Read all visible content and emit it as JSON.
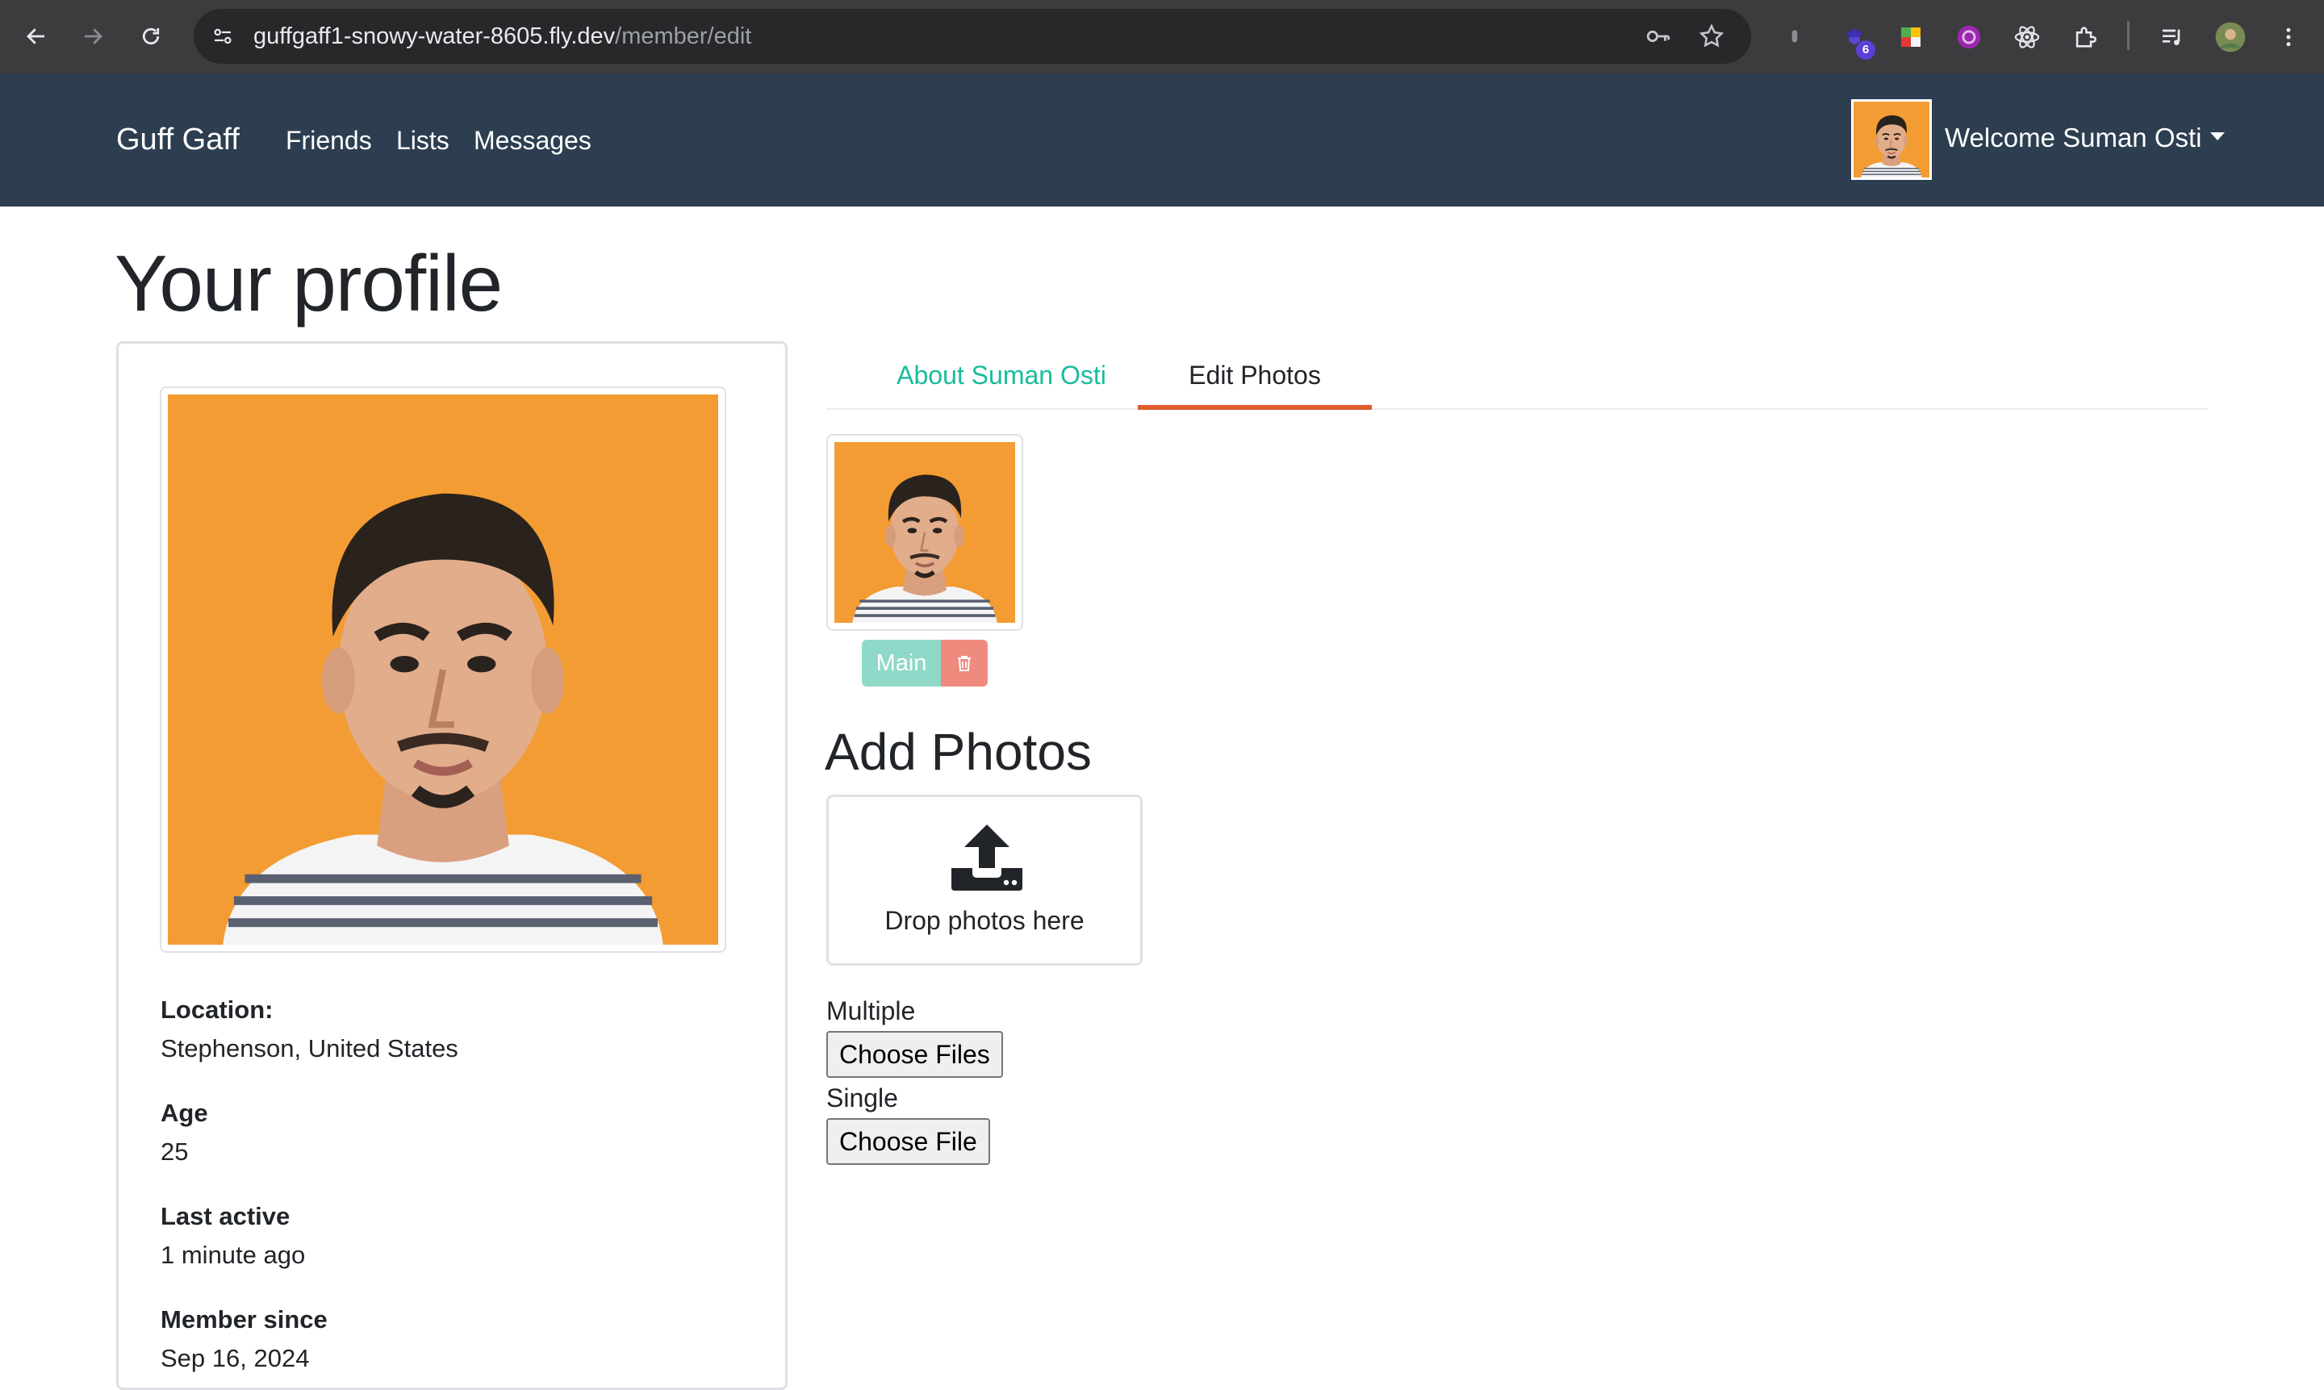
{
  "browser": {
    "url_host": "guffgaff1-snowy-water-8605.fly.dev",
    "url_path": "/member/edit",
    "extension_badge": "6"
  },
  "navbar": {
    "brand": "Guff Gaff",
    "links": [
      "Friends",
      "Lists",
      "Messages"
    ],
    "welcome": "Welcome Suman Osti"
  },
  "page": {
    "title": "Your profile"
  },
  "profile_card": {
    "fields": [
      {
        "label": "Location:",
        "value": "Stephenson, United States"
      },
      {
        "label": "Age",
        "value": "25"
      },
      {
        "label": "Last active",
        "value": "1 minute ago"
      },
      {
        "label": "Member since",
        "value": "Sep 16, 2024"
      }
    ]
  },
  "tabs": [
    {
      "label": "About Suman Osti",
      "active": false
    },
    {
      "label": "Edit Photos",
      "active": true
    }
  ],
  "photo_actions": {
    "main_label": "Main"
  },
  "add_photos": {
    "heading": "Add Photos",
    "dropzone_text": "Drop photos here",
    "multiple_label": "Multiple",
    "multiple_button": "Choose Files",
    "single_label": "Single",
    "single_button": "Choose File"
  },
  "colors": {
    "navbar": "#2c3e50",
    "accent": "#18bc9c",
    "tab_underline": "#e05a2b",
    "photo_background": "#f39c33",
    "main_button": "#8fd9c9",
    "delete_button": "#ee8a7e"
  }
}
